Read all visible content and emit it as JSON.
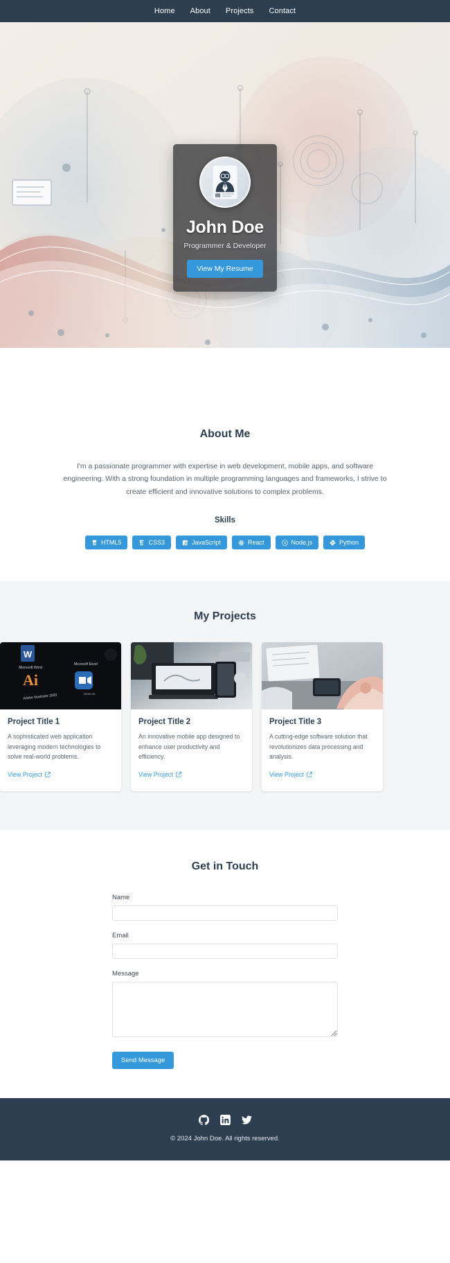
{
  "nav": {
    "items": [
      {
        "label": "Home",
        "name": "nav-link-home"
      },
      {
        "label": "About",
        "name": "nav-link-about"
      },
      {
        "label": "Projects",
        "name": "nav-link-projects"
      },
      {
        "label": "Contact",
        "name": "nav-link-contact"
      }
    ]
  },
  "hero": {
    "name": "John Doe",
    "tagline": "Programmer & Developer",
    "cta_label": "View My Resume",
    "avatar_icon": "id-card-portrait-avatar",
    "card_bg_color": "#14161a",
    "accent_color": "#3498db"
  },
  "about": {
    "title": "About Me",
    "body": "I'm a passionate programmer with expertise in web development, mobile apps, and software engineering. With a strong foundation in multiple programming languages and frameworks, I strive to create efficient and innovative solutions to complex problems.",
    "skills_title": "Skills",
    "skills": [
      {
        "label": "HTML5",
        "icon": "html5-icon"
      },
      {
        "label": "CSS3",
        "icon": "css3-icon"
      },
      {
        "label": "JavaScript",
        "icon": "javascript-icon"
      },
      {
        "label": "React",
        "icon": "react-atom-icon"
      },
      {
        "label": "Node.js",
        "icon": "nodejs-icon"
      },
      {
        "label": "Python",
        "icon": "python-icon"
      }
    ]
  },
  "projects": {
    "title": "My Projects",
    "link_label": "View Project",
    "items": [
      {
        "title": "Project Title 1",
        "description": "A sophisticated web application leveraging modern technologies to solve real-world problems.",
        "thumb": "dark-desktop-app-icons-photo"
      },
      {
        "title": "Project Title 2",
        "description": "An innovative mobile app designed to enhance user productivity and efficiency.",
        "thumb": "laptop-desk-workspace-photo"
      },
      {
        "title": "Project Title 3",
        "description": "A cutting-edge software solution that revolutionizes data processing and analysis.",
        "thumb": "hands-tablet-desk-photo"
      }
    ]
  },
  "contact": {
    "title": "Get in Touch",
    "name_label": "Name",
    "name_value": "",
    "name_placeholder": "",
    "email_label": "Email",
    "email_value": "",
    "email_placeholder": "",
    "message_label": "Message",
    "message_value": "",
    "message_placeholder": "",
    "submit_label": "Send Message"
  },
  "footer": {
    "social": [
      {
        "name": "github-icon",
        "label": "GitHub"
      },
      {
        "name": "linkedin-icon",
        "label": "LinkedIn"
      },
      {
        "name": "twitter-icon",
        "label": "Twitter"
      }
    ],
    "copyright": "© 2024 John Doe. All rights reserved."
  },
  "theme": {
    "navy": "#2c3e50",
    "accent": "#3498db",
    "page_bg": "#ffffff",
    "muted_bg": "#f4f5f6"
  }
}
